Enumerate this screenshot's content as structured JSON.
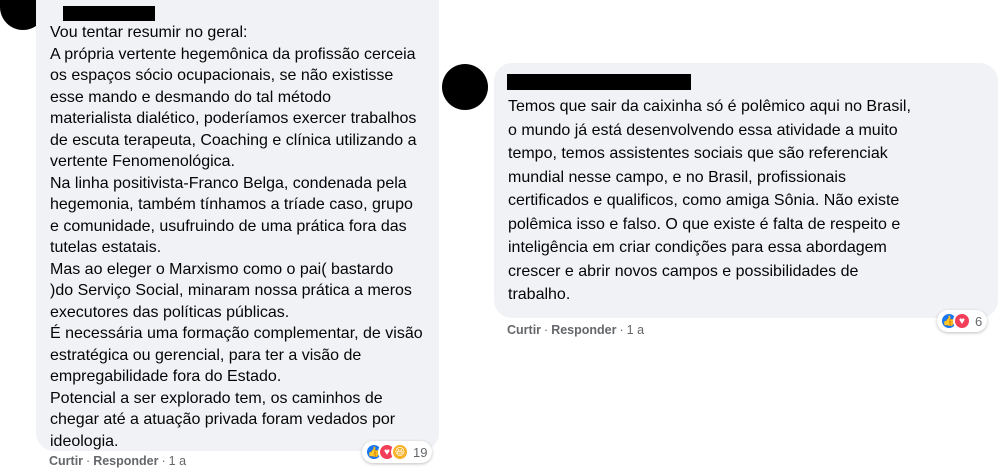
{
  "comment_1": {
    "text": "Vou tentar resumir no geral:\nA própria vertente hegemônica da profissão cerceia\nos espaços sócio ocupacionais, se não existisse\nesse mando e desmando do tal método\nmaterialista dialético, poderíamos exercer trabalhos\nde escuta terapeuta, Coaching e clínica utilizando a\nvertente Fenomenológica.\nNa linha positivista-Franco Belga, condenada pela\nhegemonia, também tínhamos a tríade caso, grupo\ne comunidade, usufruindo de uma prática fora das\ntutelas estatais.\nMas ao eleger o Marxismo como o pai( bastardo\n)do Serviço Social, minaram nossa prática a meros\nexecutores das políticas públicas.\nÉ necessária uma formação complementar, de visão\nestratégica ou gerencial, para ter a visão de\nempregabilidade fora do Estado.\nPotencial a ser explorado tem, os caminhos de\nchegar até a atuação privada foram vedados por\nideologia.",
    "like_label": "Curtir",
    "reply_label": "Responder",
    "time": "1 a",
    "reaction_count": "19",
    "reactions": [
      "like",
      "love",
      "haha"
    ]
  },
  "comment_2": {
    "text": "Temos que sair da caixinha só é polêmico aqui no Brasil,\no mundo já está desenvolvendo essa atividade a muito\ntempo, temos assistentes sociais que são referenciak\nmundial nesse campo, e no Brasil, profissionais\ncertificados e qualificos, como amiga Sônia. Não existe\npolêmica isso e falso. O que existe é falta de respeito e\ninteligência em criar condições para essa abordagem\ncrescer e abrir novos campos e possibilidades de\ntrabalho.",
    "like_label": "Curtir",
    "reply_label": "Responder",
    "time": "1 a",
    "reaction_count": "6",
    "reactions": [
      "like",
      "love"
    ]
  },
  "separator": "·",
  "colors": {
    "bubble": "#f0f2f5",
    "meta": "#65676b",
    "like": "#1877f2",
    "love": "#f33e58",
    "haha": "#f7b125"
  }
}
